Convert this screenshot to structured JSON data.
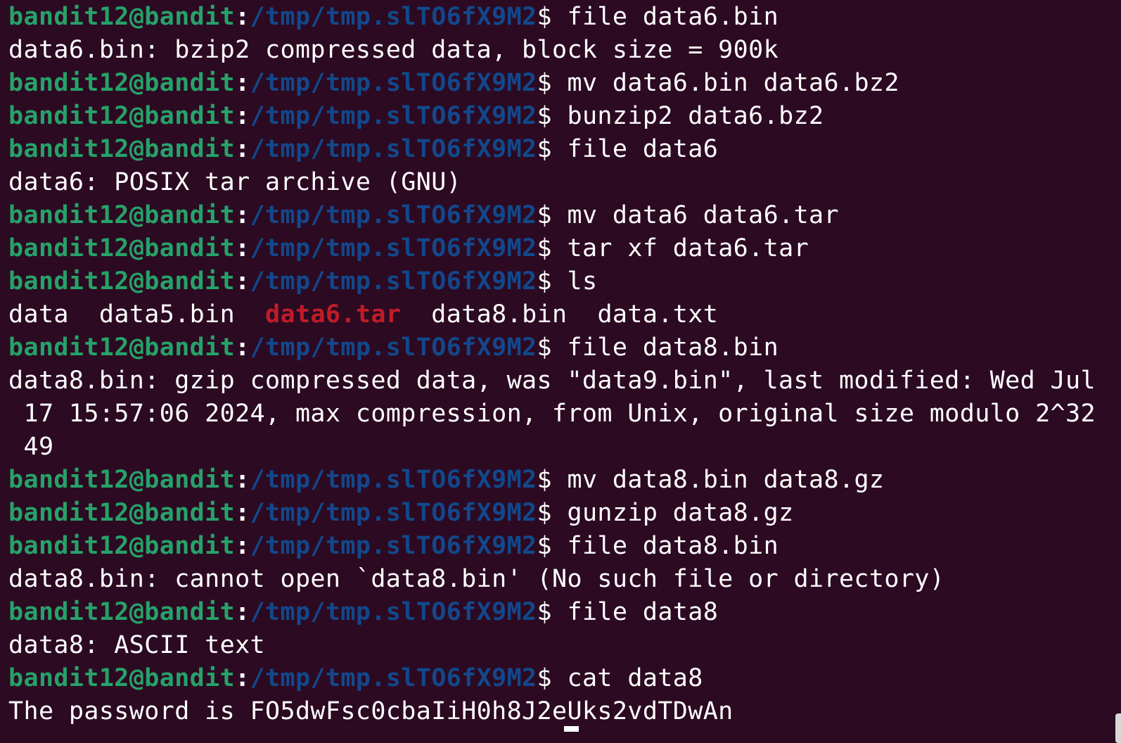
{
  "prompt": {
    "user": "bandit12@bandit",
    "separator": ":",
    "path": "/tmp/tmp.slTO6fX9M2",
    "dollar": "$"
  },
  "colors": {
    "background": "#2c0a22",
    "user": "#26a269",
    "path": "#12488b",
    "archive": "#c01c28",
    "text": "#ffffff"
  },
  "lines": [
    {
      "type": "cmd",
      "text": " file data6.bin"
    },
    {
      "type": "out",
      "text": "data6.bin: bzip2 compressed data, block size = 900k"
    },
    {
      "type": "cmd",
      "text": " mv data6.bin data6.bz2"
    },
    {
      "type": "cmd",
      "text": " bunzip2 data6.bz2"
    },
    {
      "type": "cmd",
      "text": " file data6"
    },
    {
      "type": "out",
      "text": "data6: POSIX tar archive (GNU)"
    },
    {
      "type": "cmd",
      "text": " mv data6 data6.tar"
    },
    {
      "type": "cmd",
      "text": " tar xf data6.tar"
    },
    {
      "type": "cmd",
      "text": " ls"
    },
    {
      "type": "ls"
    },
    {
      "type": "cmd",
      "text": " file data8.bin"
    },
    {
      "type": "out",
      "text": "data8.bin: gzip compressed data, was \"data9.bin\", last modified: Wed Jul"
    },
    {
      "type": "out",
      "text": " 17 15:57:06 2024, max compression, from Unix, original size modulo 2^32"
    },
    {
      "type": "out",
      "text": " 49"
    },
    {
      "type": "cmd",
      "text": " mv data8.bin data8.gz"
    },
    {
      "type": "cmd",
      "text": " gunzip data8.gz"
    },
    {
      "type": "cmd",
      "text": " file data8.bin"
    },
    {
      "type": "out",
      "text": "data8.bin: cannot open `data8.bin' (No such file or directory)"
    },
    {
      "type": "cmd",
      "text": " file data8"
    },
    {
      "type": "out",
      "text": "data8: ASCII text"
    },
    {
      "type": "cmd",
      "text": " cat data8"
    },
    {
      "type": "out",
      "text": "The password is FO5dwFsc0cbaIiH0h8J2eUks2vdTDwAn"
    }
  ],
  "ls_output": {
    "items": [
      {
        "name": "data",
        "kind": "file"
      },
      {
        "name": "data5.bin",
        "kind": "file"
      },
      {
        "name": "data6.tar",
        "kind": "archive"
      },
      {
        "name": "data8.bin",
        "kind": "file"
      },
      {
        "name": "data.txt",
        "kind": "file"
      }
    ],
    "spacing": "  "
  }
}
